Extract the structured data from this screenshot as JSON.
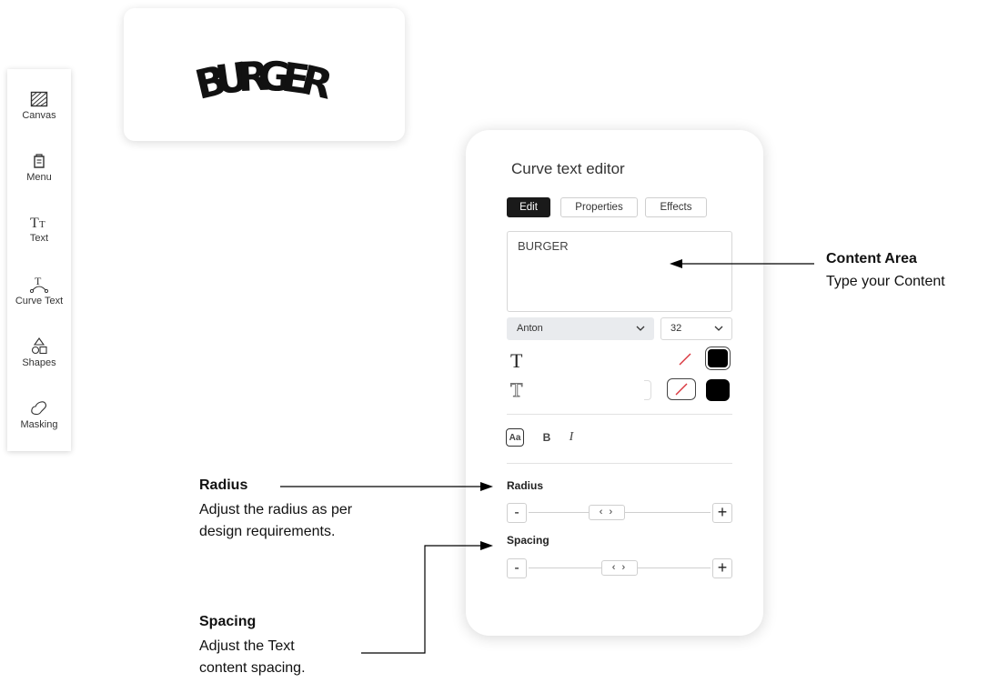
{
  "sidebar": {
    "items": [
      {
        "label": "Canvas",
        "icon": "canvas-icon"
      },
      {
        "label": "Menu",
        "icon": "menu-icon"
      },
      {
        "label": "Text",
        "icon": "text-icon"
      },
      {
        "label": "Curve Text",
        "icon": "curve-text-icon"
      },
      {
        "label": "Shapes",
        "icon": "shapes-icon"
      },
      {
        "label": "Masking",
        "icon": "masking-icon"
      }
    ]
  },
  "preview": {
    "text": "BURGER"
  },
  "editor": {
    "title": "Curve text editor",
    "tabs": [
      {
        "label": "Edit",
        "active": true
      },
      {
        "label": "Properties",
        "active": false
      },
      {
        "label": "Effects",
        "active": false
      }
    ],
    "content_value": "BURGER",
    "font_family": "Anton",
    "font_size": "32",
    "fill_icon_text": "T",
    "stroke_icon_text": "T",
    "format_buttons": [
      "Aa",
      "B",
      "I"
    ],
    "radius_label": "Radius",
    "spacing_label": "Spacing",
    "minus_label": "-",
    "plus_label": "+",
    "thumb_label": "‹ ›"
  },
  "annotations": {
    "content": {
      "title": "Content Area",
      "text": "Type your Content"
    },
    "radius": {
      "title": "Radius",
      "line1": "Adjust the radius as per",
      "line2": "design requirements."
    },
    "spacing": {
      "title": "Spacing",
      "line1": "Adjust the Text",
      "line2": "content spacing."
    }
  },
  "colors": {
    "accent": "#1a1a1a",
    "swatch_fill": "#000000",
    "none_slash": "#d9363e"
  }
}
